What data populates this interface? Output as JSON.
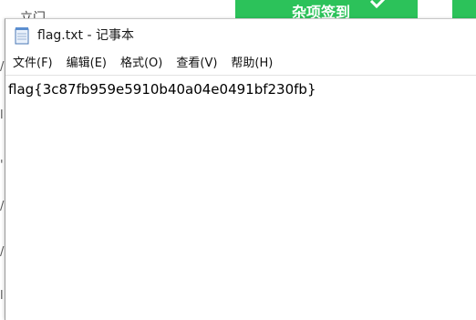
{
  "background": {
    "left_text": "立门",
    "button_text": "杂项签到",
    "accent_color": "#2cc25a",
    "check_icon": "check-icon",
    "left_marks": [
      "/",
      "l",
      "'",
      "/",
      "/",
      "l"
    ]
  },
  "window": {
    "title": "flag.txt - 记事本",
    "icon": "notepad-icon"
  },
  "menu": {
    "items": [
      {
        "label": "文件(F)"
      },
      {
        "label": "编辑(E)"
      },
      {
        "label": "格式(O)"
      },
      {
        "label": "查看(V)"
      },
      {
        "label": "帮助(H)"
      }
    ]
  },
  "editor": {
    "content": "flag{3c87fb959e5910b40a04e0491bf230fb}"
  }
}
